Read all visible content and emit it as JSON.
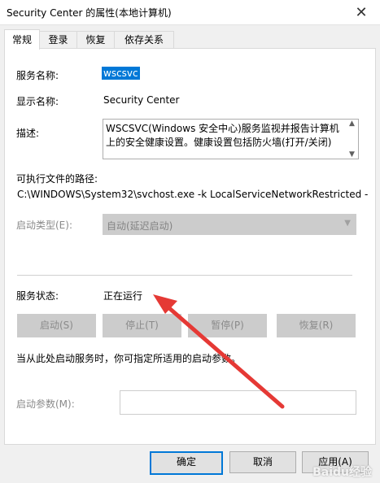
{
  "window": {
    "title": "Security Center 的属性(本地计算机)",
    "close": "✕"
  },
  "tabs": [
    {
      "label": "常规"
    },
    {
      "label": "登录"
    },
    {
      "label": "恢复"
    },
    {
      "label": "依存关系"
    }
  ],
  "general": {
    "service_name_label": "服务名称:",
    "service_name_value": "wscsvc",
    "display_name_label": "显示名称:",
    "display_name_value": "Security Center",
    "description_label": "描述:",
    "description_value": "WSCSVC(Windows 安全中心)服务监视并报告计算机上的安全健康设置。健康设置包括防火墙(打开/关闭)",
    "path_label": "可执行文件的路径:",
    "path_value": "C:\\WINDOWS\\System32\\svchost.exe -k LocalServiceNetworkRestricted -",
    "startup_type_label": "启动类型(E):",
    "startup_type_value": "自动(延迟启动)",
    "status_label": "服务状态:",
    "status_value": "正在运行",
    "buttons": {
      "start": "启动(S)",
      "stop": "停止(T)",
      "pause": "暂停(P)",
      "resume": "恢复(R)"
    },
    "hint": "当从此处启动服务时，你可指定所适用的启动参数。",
    "params_label": "启动参数(M):",
    "params_value": ""
  },
  "footer": {
    "ok": "确定",
    "cancel": "取消",
    "apply": "应用(A)"
  },
  "watermark": "Baidu经验",
  "colors": {
    "selection": "#0078d7",
    "annotation_arrow": "#e53935"
  }
}
